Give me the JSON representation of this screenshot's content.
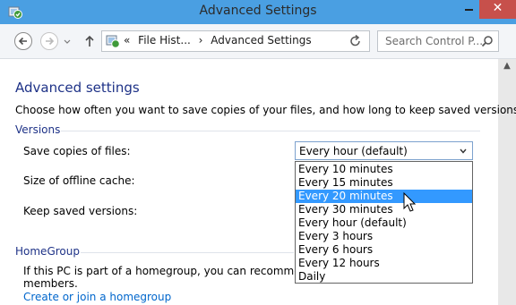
{
  "window": {
    "title": "Advanced Settings"
  },
  "navbar": {
    "address_parts": [
      "«",
      "File Hist...",
      "›",
      "Advanced Settings"
    ],
    "address_dropdown_glyph": "v",
    "search_placeholder": "Search Control P..."
  },
  "page": {
    "title": "Advanced settings",
    "intro": "Choose how often you want to save copies of your files, and how long to keep saved versions.",
    "versions_header": "Versions",
    "save_copies_label": "Save copies of files:",
    "offline_cache_label": "Size of offline cache:",
    "keep_versions_label": "Keep saved versions:",
    "homegroup_header": "HomeGroup",
    "homegroup_text_1": "If this PC is part of a homegroup, you can recommend thi",
    "homegroup_text_2": "members.",
    "homegroup_link": "Create or join a homegroup"
  },
  "save_copies": {
    "selected_value": "Every hour (default)",
    "highlighted_option": "Every 20 minutes",
    "options": [
      "Every 10 minutes",
      "Every 15 minutes",
      "Every 20 minutes",
      "Every 30 minutes",
      "Every hour (default)",
      "Every 3 hours",
      "Every 6 hours",
      "Every 12 hours",
      "Daily"
    ]
  },
  "colors": {
    "titlebar": "#4a9fe2",
    "close_button": "#c7504b",
    "heading_blue": "#1e3287",
    "link_blue": "#0066cc",
    "selection": "#3399ff"
  },
  "icons": {
    "app": "file-history-icon",
    "back": "back-arrow-icon",
    "forward": "forward-arrow-icon",
    "up": "up-arrow-icon",
    "refresh": "refresh-icon",
    "search": "search-icon",
    "pointer": "mouse-pointer-icon"
  }
}
